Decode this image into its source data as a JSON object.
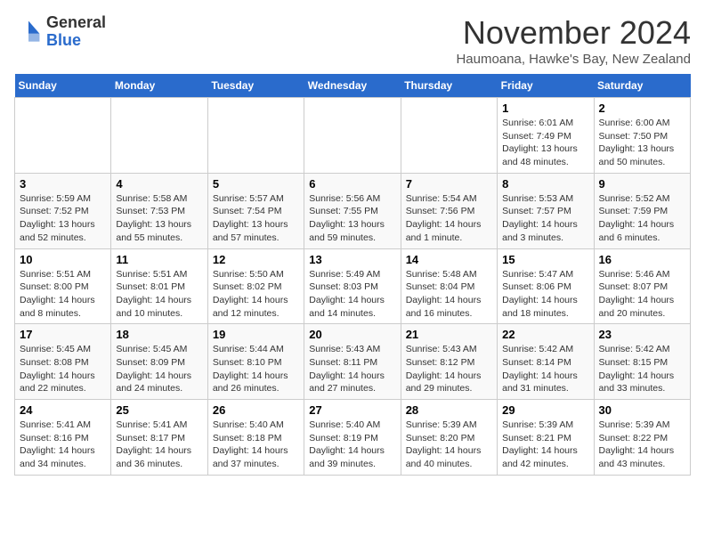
{
  "logo": {
    "general": "General",
    "blue": "Blue"
  },
  "header": {
    "month": "November 2024",
    "location": "Haumoana, Hawke's Bay, New Zealand"
  },
  "weekdays": [
    "Sunday",
    "Monday",
    "Tuesday",
    "Wednesday",
    "Thursday",
    "Friday",
    "Saturday"
  ],
  "weeks": [
    [
      {
        "day": "",
        "info": ""
      },
      {
        "day": "",
        "info": ""
      },
      {
        "day": "",
        "info": ""
      },
      {
        "day": "",
        "info": ""
      },
      {
        "day": "",
        "info": ""
      },
      {
        "day": "1",
        "info": "Sunrise: 6:01 AM\nSunset: 7:49 PM\nDaylight: 13 hours and 48 minutes."
      },
      {
        "day": "2",
        "info": "Sunrise: 6:00 AM\nSunset: 7:50 PM\nDaylight: 13 hours and 50 minutes."
      }
    ],
    [
      {
        "day": "3",
        "info": "Sunrise: 5:59 AM\nSunset: 7:52 PM\nDaylight: 13 hours and 52 minutes."
      },
      {
        "day": "4",
        "info": "Sunrise: 5:58 AM\nSunset: 7:53 PM\nDaylight: 13 hours and 55 minutes."
      },
      {
        "day": "5",
        "info": "Sunrise: 5:57 AM\nSunset: 7:54 PM\nDaylight: 13 hours and 57 minutes."
      },
      {
        "day": "6",
        "info": "Sunrise: 5:56 AM\nSunset: 7:55 PM\nDaylight: 13 hours and 59 minutes."
      },
      {
        "day": "7",
        "info": "Sunrise: 5:54 AM\nSunset: 7:56 PM\nDaylight: 14 hours and 1 minute."
      },
      {
        "day": "8",
        "info": "Sunrise: 5:53 AM\nSunset: 7:57 PM\nDaylight: 14 hours and 3 minutes."
      },
      {
        "day": "9",
        "info": "Sunrise: 5:52 AM\nSunset: 7:59 PM\nDaylight: 14 hours and 6 minutes."
      }
    ],
    [
      {
        "day": "10",
        "info": "Sunrise: 5:51 AM\nSunset: 8:00 PM\nDaylight: 14 hours and 8 minutes."
      },
      {
        "day": "11",
        "info": "Sunrise: 5:51 AM\nSunset: 8:01 PM\nDaylight: 14 hours and 10 minutes."
      },
      {
        "day": "12",
        "info": "Sunrise: 5:50 AM\nSunset: 8:02 PM\nDaylight: 14 hours and 12 minutes."
      },
      {
        "day": "13",
        "info": "Sunrise: 5:49 AM\nSunset: 8:03 PM\nDaylight: 14 hours and 14 minutes."
      },
      {
        "day": "14",
        "info": "Sunrise: 5:48 AM\nSunset: 8:04 PM\nDaylight: 14 hours and 16 minutes."
      },
      {
        "day": "15",
        "info": "Sunrise: 5:47 AM\nSunset: 8:06 PM\nDaylight: 14 hours and 18 minutes."
      },
      {
        "day": "16",
        "info": "Sunrise: 5:46 AM\nSunset: 8:07 PM\nDaylight: 14 hours and 20 minutes."
      }
    ],
    [
      {
        "day": "17",
        "info": "Sunrise: 5:45 AM\nSunset: 8:08 PM\nDaylight: 14 hours and 22 minutes."
      },
      {
        "day": "18",
        "info": "Sunrise: 5:45 AM\nSunset: 8:09 PM\nDaylight: 14 hours and 24 minutes."
      },
      {
        "day": "19",
        "info": "Sunrise: 5:44 AM\nSunset: 8:10 PM\nDaylight: 14 hours and 26 minutes."
      },
      {
        "day": "20",
        "info": "Sunrise: 5:43 AM\nSunset: 8:11 PM\nDaylight: 14 hours and 27 minutes."
      },
      {
        "day": "21",
        "info": "Sunrise: 5:43 AM\nSunset: 8:12 PM\nDaylight: 14 hours and 29 minutes."
      },
      {
        "day": "22",
        "info": "Sunrise: 5:42 AM\nSunset: 8:14 PM\nDaylight: 14 hours and 31 minutes."
      },
      {
        "day": "23",
        "info": "Sunrise: 5:42 AM\nSunset: 8:15 PM\nDaylight: 14 hours and 33 minutes."
      }
    ],
    [
      {
        "day": "24",
        "info": "Sunrise: 5:41 AM\nSunset: 8:16 PM\nDaylight: 14 hours and 34 minutes."
      },
      {
        "day": "25",
        "info": "Sunrise: 5:41 AM\nSunset: 8:17 PM\nDaylight: 14 hours and 36 minutes."
      },
      {
        "day": "26",
        "info": "Sunrise: 5:40 AM\nSunset: 8:18 PM\nDaylight: 14 hours and 37 minutes."
      },
      {
        "day": "27",
        "info": "Sunrise: 5:40 AM\nSunset: 8:19 PM\nDaylight: 14 hours and 39 minutes."
      },
      {
        "day": "28",
        "info": "Sunrise: 5:39 AM\nSunset: 8:20 PM\nDaylight: 14 hours and 40 minutes."
      },
      {
        "day": "29",
        "info": "Sunrise: 5:39 AM\nSunset: 8:21 PM\nDaylight: 14 hours and 42 minutes."
      },
      {
        "day": "30",
        "info": "Sunrise: 5:39 AM\nSunset: 8:22 PM\nDaylight: 14 hours and 43 minutes."
      }
    ]
  ]
}
